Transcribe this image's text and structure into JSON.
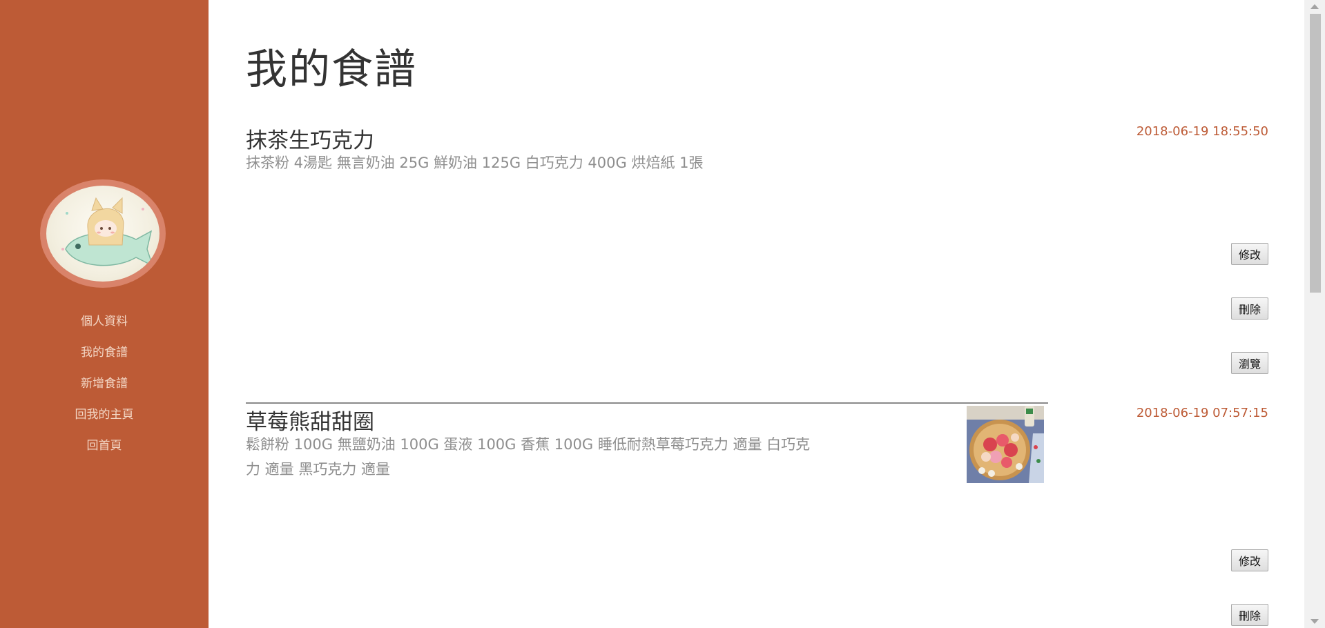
{
  "colors": {
    "sidebar": "#bd5b36",
    "nav_text": "#f3d6c4",
    "date_text": "#bd5b36",
    "ingredient_text": "#8e8e8e"
  },
  "sidebar": {
    "avatar": "avatar-illustration",
    "nav": [
      {
        "label": "個人資料"
      },
      {
        "label": "我的食譜"
      },
      {
        "label": "新增食譜"
      },
      {
        "label": "回我的主頁"
      },
      {
        "label": "回首頁"
      }
    ]
  },
  "main": {
    "title": "我的食譜",
    "recipes": [
      {
        "name": "抹茶生巧克力",
        "ingredients": "抹茶粉 4湯匙 無言奶油 25G 鮮奶油 125G 白巧克力 400G 烘焙紙 1張",
        "date": "2018-06-19 18:55:50",
        "has_photo": false,
        "buttons": {
          "edit": "修改",
          "delete": "刪除",
          "view": "瀏覽"
        }
      },
      {
        "name": "草莓熊甜甜圈",
        "ingredients": "鬆餅粉 100G 無鹽奶油 100G 蛋液 100G 香蕉 100G 睡低耐熱草莓巧克力 適量 白巧克力 適量 黑巧克力 適量",
        "date": "2018-06-19 07:57:15",
        "has_photo": true,
        "photo": "strawberry-donut-photo",
        "buttons": {
          "edit": "修改",
          "delete": "刪除"
        }
      }
    ]
  }
}
